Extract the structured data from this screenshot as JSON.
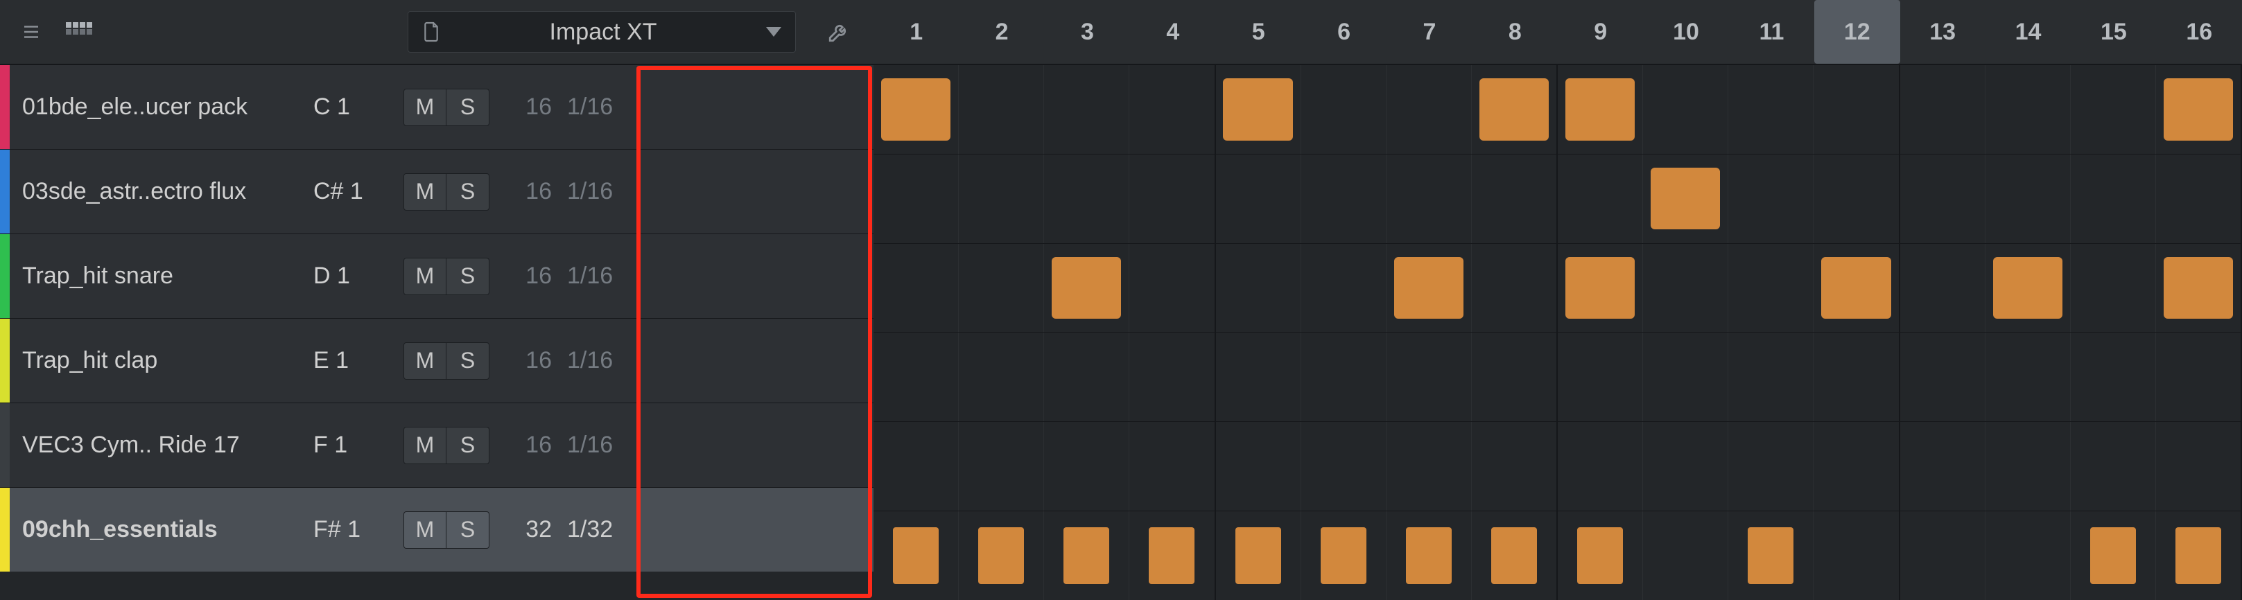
{
  "header": {
    "instrument_name": "Impact XT"
  },
  "cursor_step": 12,
  "step_labels": [
    "1",
    "2",
    "3",
    "4",
    "5",
    "6",
    "7",
    "8",
    "9",
    "10",
    "11",
    "12",
    "13",
    "14",
    "15",
    "16"
  ],
  "tracks": [
    {
      "color": "#d92f5f",
      "name": "01bde_ele..ucer pack",
      "note": "C 1",
      "mute": "M",
      "solo": "S",
      "steps": "16",
      "res": "1/16",
      "selected": false,
      "small": false,
      "pattern": [
        1,
        0,
        0,
        0,
        1,
        0,
        0,
        1,
        1,
        0,
        0,
        0,
        0,
        0,
        0,
        1
      ]
    },
    {
      "color": "#2f7fd9",
      "name": "03sde_astr..ectro flux",
      "note": "C# 1",
      "mute": "M",
      "solo": "S",
      "steps": "16",
      "res": "1/16",
      "selected": false,
      "small": false,
      "pattern": [
        0,
        0,
        0,
        0,
        0,
        0,
        0,
        0,
        0,
        1,
        0,
        0,
        0,
        0,
        0,
        0
      ]
    },
    {
      "color": "#2fbf4f",
      "name": "Trap_hit snare",
      "note": "D 1",
      "mute": "M",
      "solo": "S",
      "steps": "16",
      "res": "1/16",
      "selected": false,
      "small": false,
      "pattern": [
        0,
        0,
        1,
        0,
        0,
        0,
        1,
        0,
        1,
        0,
        0,
        1,
        0,
        1,
        0,
        1
      ]
    },
    {
      "color": "#d7e02f",
      "name": "Trap_hit clap",
      "note": "E 1",
      "mute": "M",
      "solo": "S",
      "steps": "16",
      "res": "1/16",
      "selected": false,
      "small": false,
      "pattern": [
        0,
        0,
        0,
        0,
        0,
        0,
        0,
        0,
        0,
        0,
        0,
        0,
        0,
        0,
        0,
        0
      ]
    },
    {
      "color": "#3a3e42",
      "name": "VEC3 Cym.. Ride 17",
      "note": "F 1",
      "mute": "M",
      "solo": "S",
      "steps": "16",
      "res": "1/16",
      "selected": false,
      "small": false,
      "pattern": [
        0,
        0,
        0,
        0,
        0,
        0,
        0,
        0,
        0,
        0,
        0,
        0,
        0,
        0,
        0,
        0
      ]
    },
    {
      "color": "#f0e02f",
      "name": "09chh_essentials",
      "note": "F# 1",
      "mute": "M",
      "solo": "S",
      "steps": "32",
      "res": "1/32",
      "selected": true,
      "small": true,
      "pattern": [
        1,
        1,
        1,
        1,
        1,
        1,
        1,
        1,
        1,
        0,
        1,
        0,
        0,
        0,
        1,
        1
      ]
    }
  ]
}
